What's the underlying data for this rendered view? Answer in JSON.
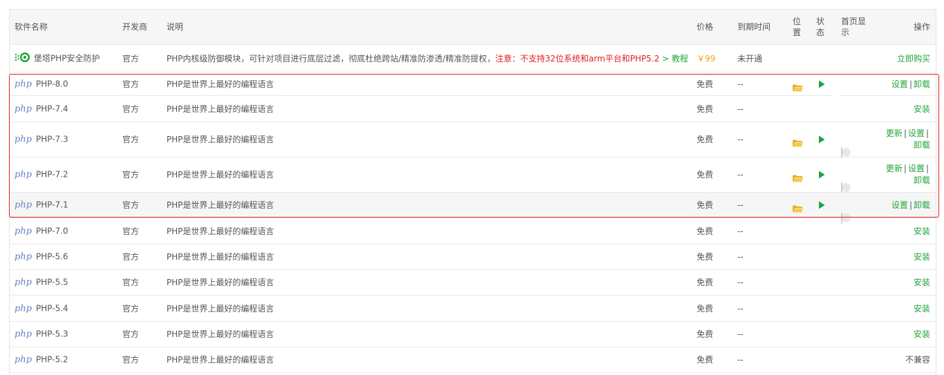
{
  "header": {
    "name": "软件名称",
    "developer": "开发商",
    "description": "说明",
    "price": "价格",
    "expiry": "到期时间",
    "position_l1": "位",
    "position_l2": "置",
    "status_l1": "状",
    "status_l2": "态",
    "homepage_l1": "首页显",
    "homepage_l2": "示",
    "operation": "操作"
  },
  "featured": {
    "name": "堡塔PHP安全防护",
    "developer": "官方",
    "description": "PHP内核级防御模块，可针对项目进行底层过滤，彻底杜绝跨站/精准防渗透/精准防提权，",
    "warning": "注意：不支持32位系统和arm平台和PHP5.2",
    "tutorial": " > 教程",
    "price": "￥99",
    "expiry": "未开通",
    "action": "立即购买",
    "icon": "shield-plugin-icon"
  },
  "php_logo_text": "php",
  "rows": [
    {
      "name": "PHP-8.0",
      "developer": "官方",
      "description": "PHP是世界上最好的编程语言",
      "price": "免费",
      "expiry": "--",
      "installed": true,
      "home_on": true,
      "ops": [
        "设置",
        "卸载"
      ]
    },
    {
      "name": "PHP-7.4",
      "developer": "官方",
      "description": "PHP是世界上最好的编程语言",
      "price": "免费",
      "expiry": "--",
      "installed": false,
      "ops": [
        "安装"
      ]
    },
    {
      "name": "PHP-7.3",
      "developer": "官方",
      "description": "PHP是世界上最好的编程语言",
      "price": "免费",
      "expiry": "--",
      "installed": true,
      "home_on": false,
      "ops": [
        "更新",
        "设置",
        "卸载"
      ]
    },
    {
      "name": "PHP-7.2",
      "developer": "官方",
      "description": "PHP是世界上最好的编程语言",
      "price": "免费",
      "expiry": "--",
      "installed": true,
      "home_on": false,
      "ops": [
        "更新",
        "设置",
        "卸载"
      ]
    },
    {
      "name": "PHP-7.1",
      "developer": "官方",
      "description": "PHP是世界上最好的编程语言",
      "price": "免费",
      "expiry": "--",
      "installed": true,
      "home_on": false,
      "ops": [
        "设置",
        "卸载"
      ]
    },
    {
      "name": "PHP-7.0",
      "developer": "官方",
      "description": "PHP是世界上最好的编程语言",
      "price": "免费",
      "expiry": "--",
      "installed": false,
      "ops": [
        "安装"
      ]
    },
    {
      "name": "PHP-5.6",
      "developer": "官方",
      "description": "PHP是世界上最好的编程语言",
      "price": "免费",
      "expiry": "--",
      "installed": false,
      "ops": [
        "安装"
      ]
    },
    {
      "name": "PHP-5.5",
      "developer": "官方",
      "description": "PHP是世界上最好的编程语言",
      "price": "免费",
      "expiry": "--",
      "installed": false,
      "ops": [
        "安装"
      ]
    },
    {
      "name": "PHP-5.4",
      "developer": "官方",
      "description": "PHP是世界上最好的编程语言",
      "price": "免费",
      "expiry": "--",
      "installed": false,
      "ops": [
        "安装"
      ]
    },
    {
      "name": "PHP-5.3",
      "developer": "官方",
      "description": "PHP是世界上最好的编程语言",
      "price": "免费",
      "expiry": "--",
      "installed": false,
      "ops": [
        "安装"
      ]
    },
    {
      "name": "PHP-5.2",
      "developer": "官方",
      "description": "PHP是世界上最好的编程语言",
      "price": "免费",
      "expiry": "--",
      "installed": false,
      "incompatible": true,
      "ops": [
        "不兼容"
      ]
    }
  ],
  "colors": {
    "accent_green": "#20a53a",
    "warning_red": "#e02020",
    "price_orange": "#f0a020",
    "folder_yellow": "#f0c040"
  },
  "ops_separator": "|"
}
